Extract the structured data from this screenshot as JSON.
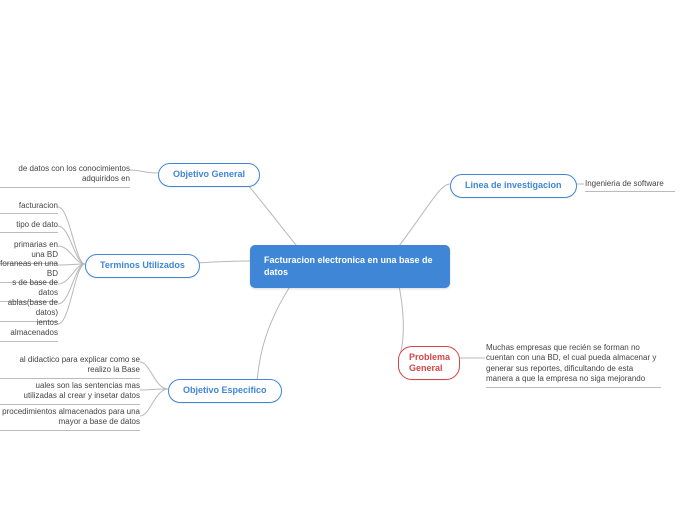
{
  "center": {
    "title": "Facturacion electronica en una base de datos"
  },
  "branches": {
    "objetivo_general": {
      "label": "Objetivo General"
    },
    "terminos": {
      "label": "Terminos Utilizados"
    },
    "objetivo_especifico": {
      "label": "Objetivo Especifico"
    },
    "linea": {
      "label": "Linea de investigacion"
    },
    "problema": {
      "label": "Problema General"
    }
  },
  "leaves": {
    "og1": "de datos con los conocimientos  adquiridos en",
    "t1": "facturacion",
    "t2": "tipo de dato",
    "t3": "primarias en una BD",
    "t4": "foraneas en una BD",
    "t5": "s de base de datos",
    "t6": "ablas(base de datos)",
    "t7": "ientos almacenados",
    "oe1": "al didactico para explicar como se realizo la Base",
    "oe2": "uales son las sentencias mas utilizadas al crear y insetar datos",
    "oe3": "procedimientos almacenados para una mayor a base de datos",
    "li1": "Ingenieria de software",
    "pg1": "Muchas empresas que recién se forman no cuentan con una BD, el cual pueda almacenar y generar sus reportes, dificultando de esta manera a que la empresa no siga mejorando"
  }
}
